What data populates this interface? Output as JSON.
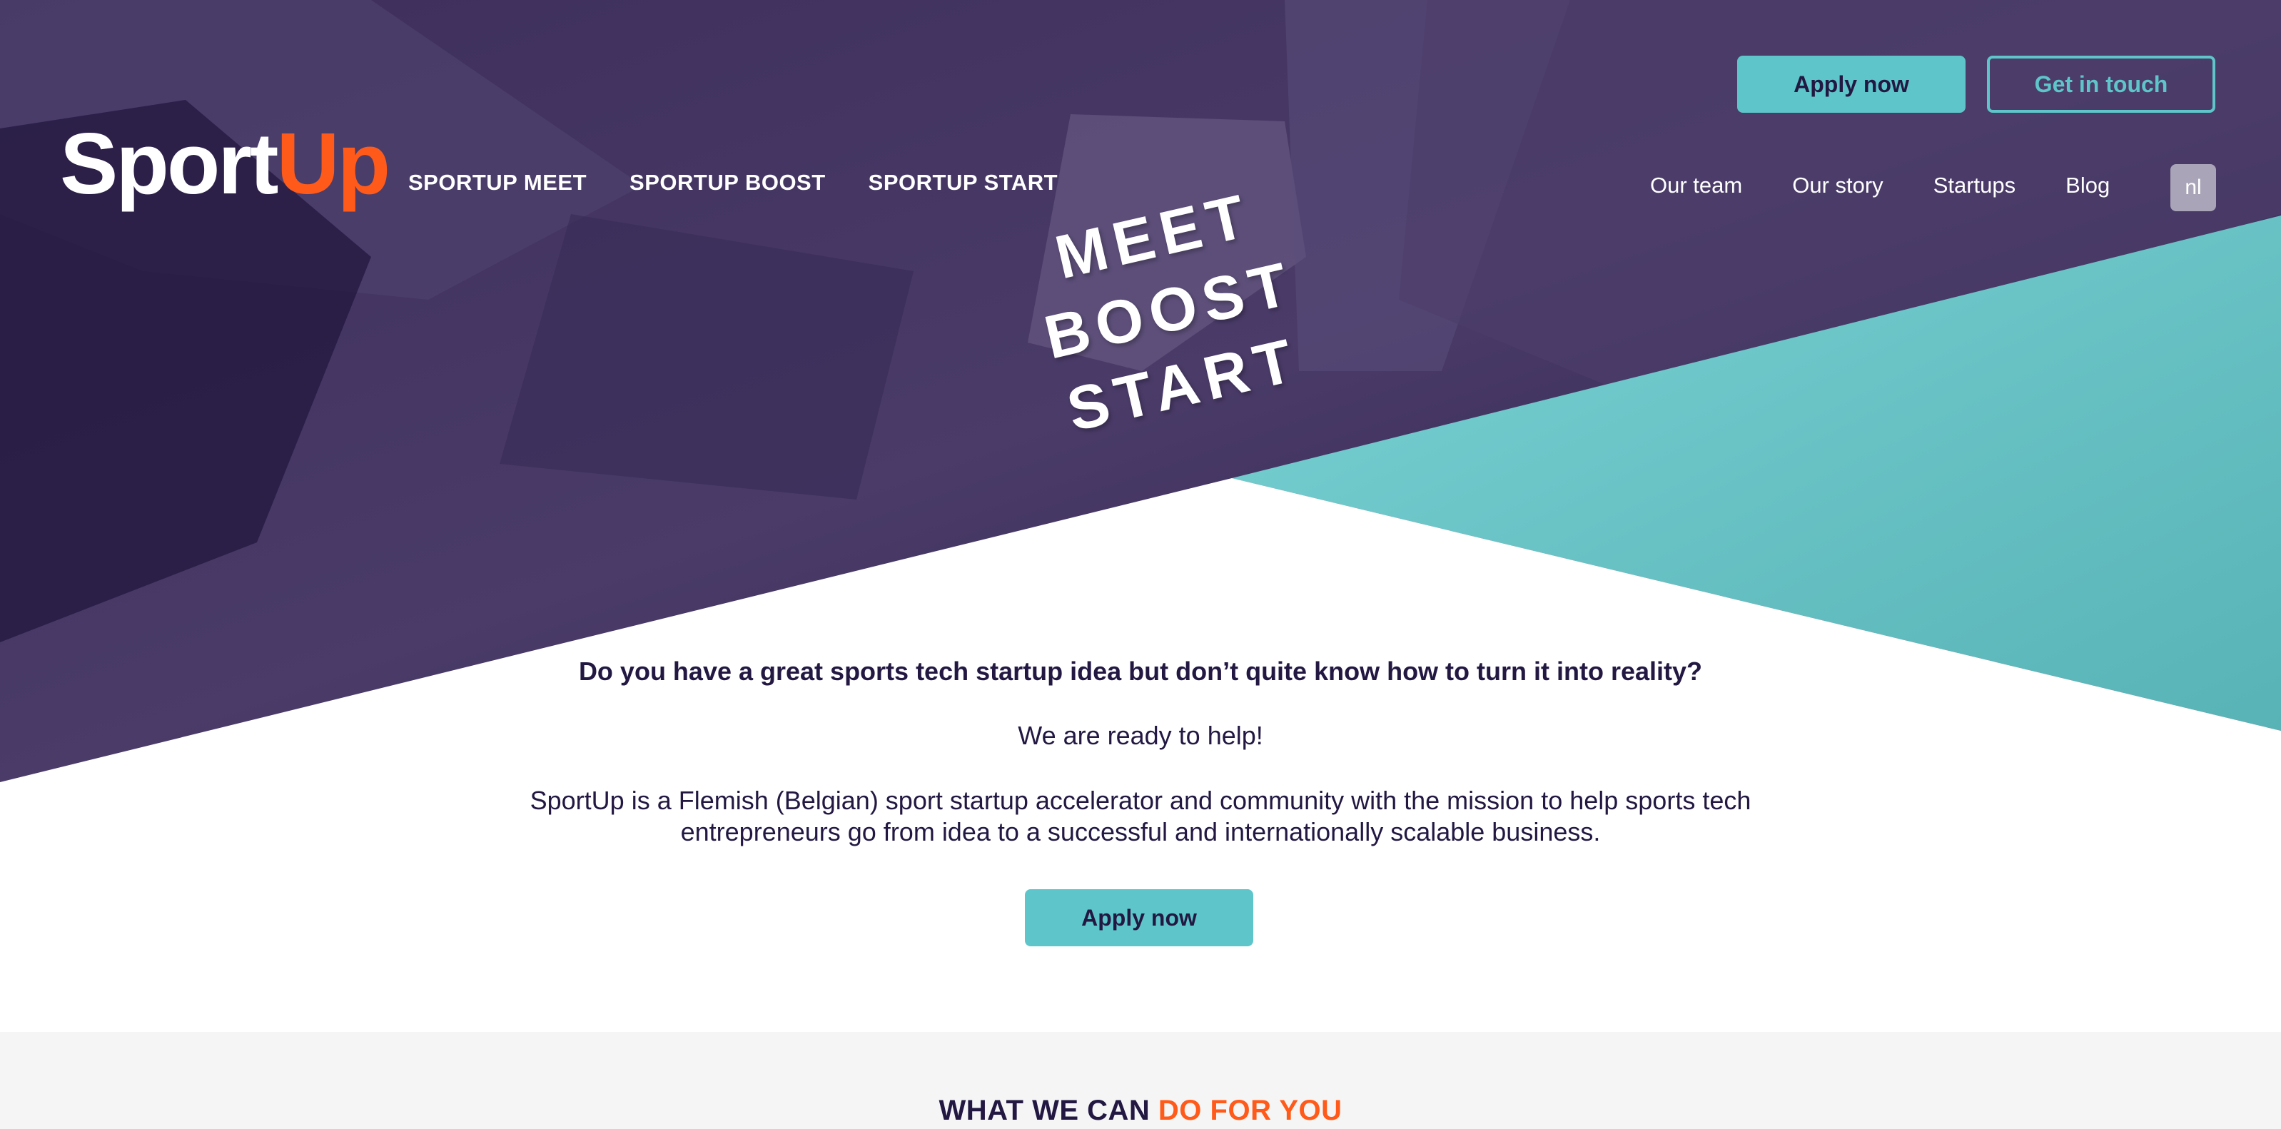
{
  "brand": {
    "logo_part1": "Sport",
    "logo_part2": "Up",
    "accent_color": "#ff5a1a",
    "teal_color": "#5ec6cb",
    "purple_color": "#221842"
  },
  "main_nav": {
    "items": [
      {
        "label": "SPORTUP MEET"
      },
      {
        "label": "SPORTUP BOOST"
      },
      {
        "label": "SPORTUP START"
      }
    ]
  },
  "top_actions": {
    "apply_label": "Apply now",
    "contact_label": "Get in touch"
  },
  "secondary_nav": {
    "items": [
      {
        "label": "Our team"
      },
      {
        "label": "Our story"
      },
      {
        "label": "Startups"
      },
      {
        "label": "Blog"
      }
    ],
    "language": "nl"
  },
  "hero": {
    "slogan": [
      "MEET",
      "BOOST",
      "START"
    ]
  },
  "intro": {
    "question": "Do you have a great sports tech startup idea but don’t quite know how to turn it into reality?",
    "ready": "We are ready to help!",
    "description": "SportUp is a Flemish (Belgian) sport startup accelerator and community with the mission to help sports tech entrepreneurs go from idea to a successful and internationally scalable business.",
    "cta_label": "Apply now"
  },
  "section": {
    "title_part1": "WHAT WE CAN",
    "title_part2": "DO FOR YOU"
  }
}
